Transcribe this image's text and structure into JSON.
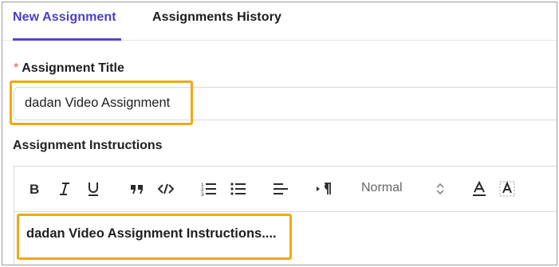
{
  "tabs": [
    {
      "label": "New Assignment",
      "active": true
    },
    {
      "label": "Assignments History",
      "active": false
    }
  ],
  "form": {
    "title_required_marker": "*",
    "title_label": "Assignment Title",
    "title_value": "dadan Video Assignment",
    "instructions_label": "Assignment Instructions",
    "instructions_value": "dadan Video Assignment Instructions...."
  },
  "toolbar": {
    "buttons": [
      "bold-icon",
      "italic-icon",
      "underline-icon",
      "blockquote-icon",
      "code-block-icon",
      "ordered-list-icon",
      "bullet-list-icon",
      "align-icon",
      "text-direction-icon",
      "text-color-icon",
      "background-color-icon"
    ],
    "format_value": "Normal"
  },
  "colors": {
    "accent": "#4a3ec6",
    "highlight": "#f2a812",
    "required": "#e25555"
  }
}
